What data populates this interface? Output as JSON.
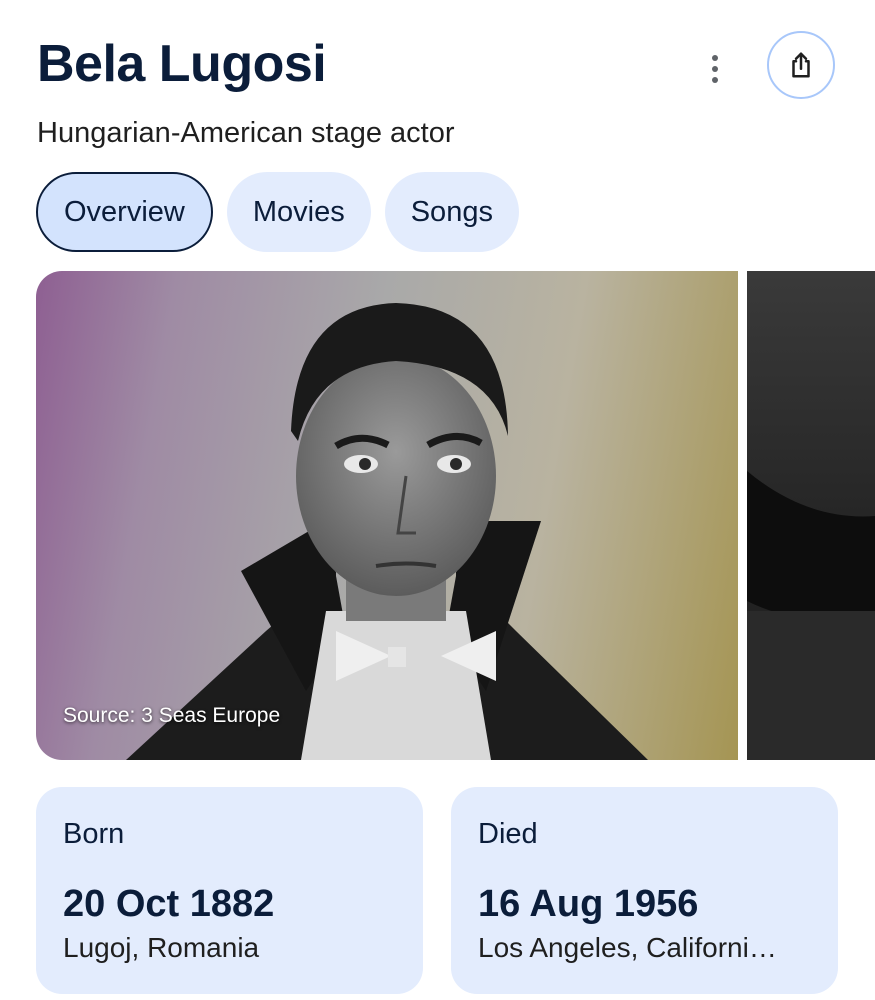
{
  "header": {
    "title": "Bela Lugosi",
    "subtitle": "Hungarian-American stage actor",
    "more_icon": "more-vert-icon",
    "share_icon": "share-icon"
  },
  "tabs": [
    {
      "label": "Overview",
      "active": true
    },
    {
      "label": "Movies",
      "active": false
    },
    {
      "label": "Songs",
      "active": false
    }
  ],
  "images": {
    "main_source": "Source: 3 Seas Europe"
  },
  "facts": {
    "born": {
      "label": "Born",
      "date": "20 Oct 1882",
      "place": "Lugoj, Romania"
    },
    "died": {
      "label": "Died",
      "date": "16 Aug 1956",
      "place": "Los Angeles, Californi…"
    }
  },
  "colors": {
    "title": "#0b1d3a",
    "tab_bg": "#e3ecfd",
    "tab_active_bg": "#d3e3fd",
    "share_border": "#a8c7fa",
    "card_bg": "#e3ecfd"
  }
}
